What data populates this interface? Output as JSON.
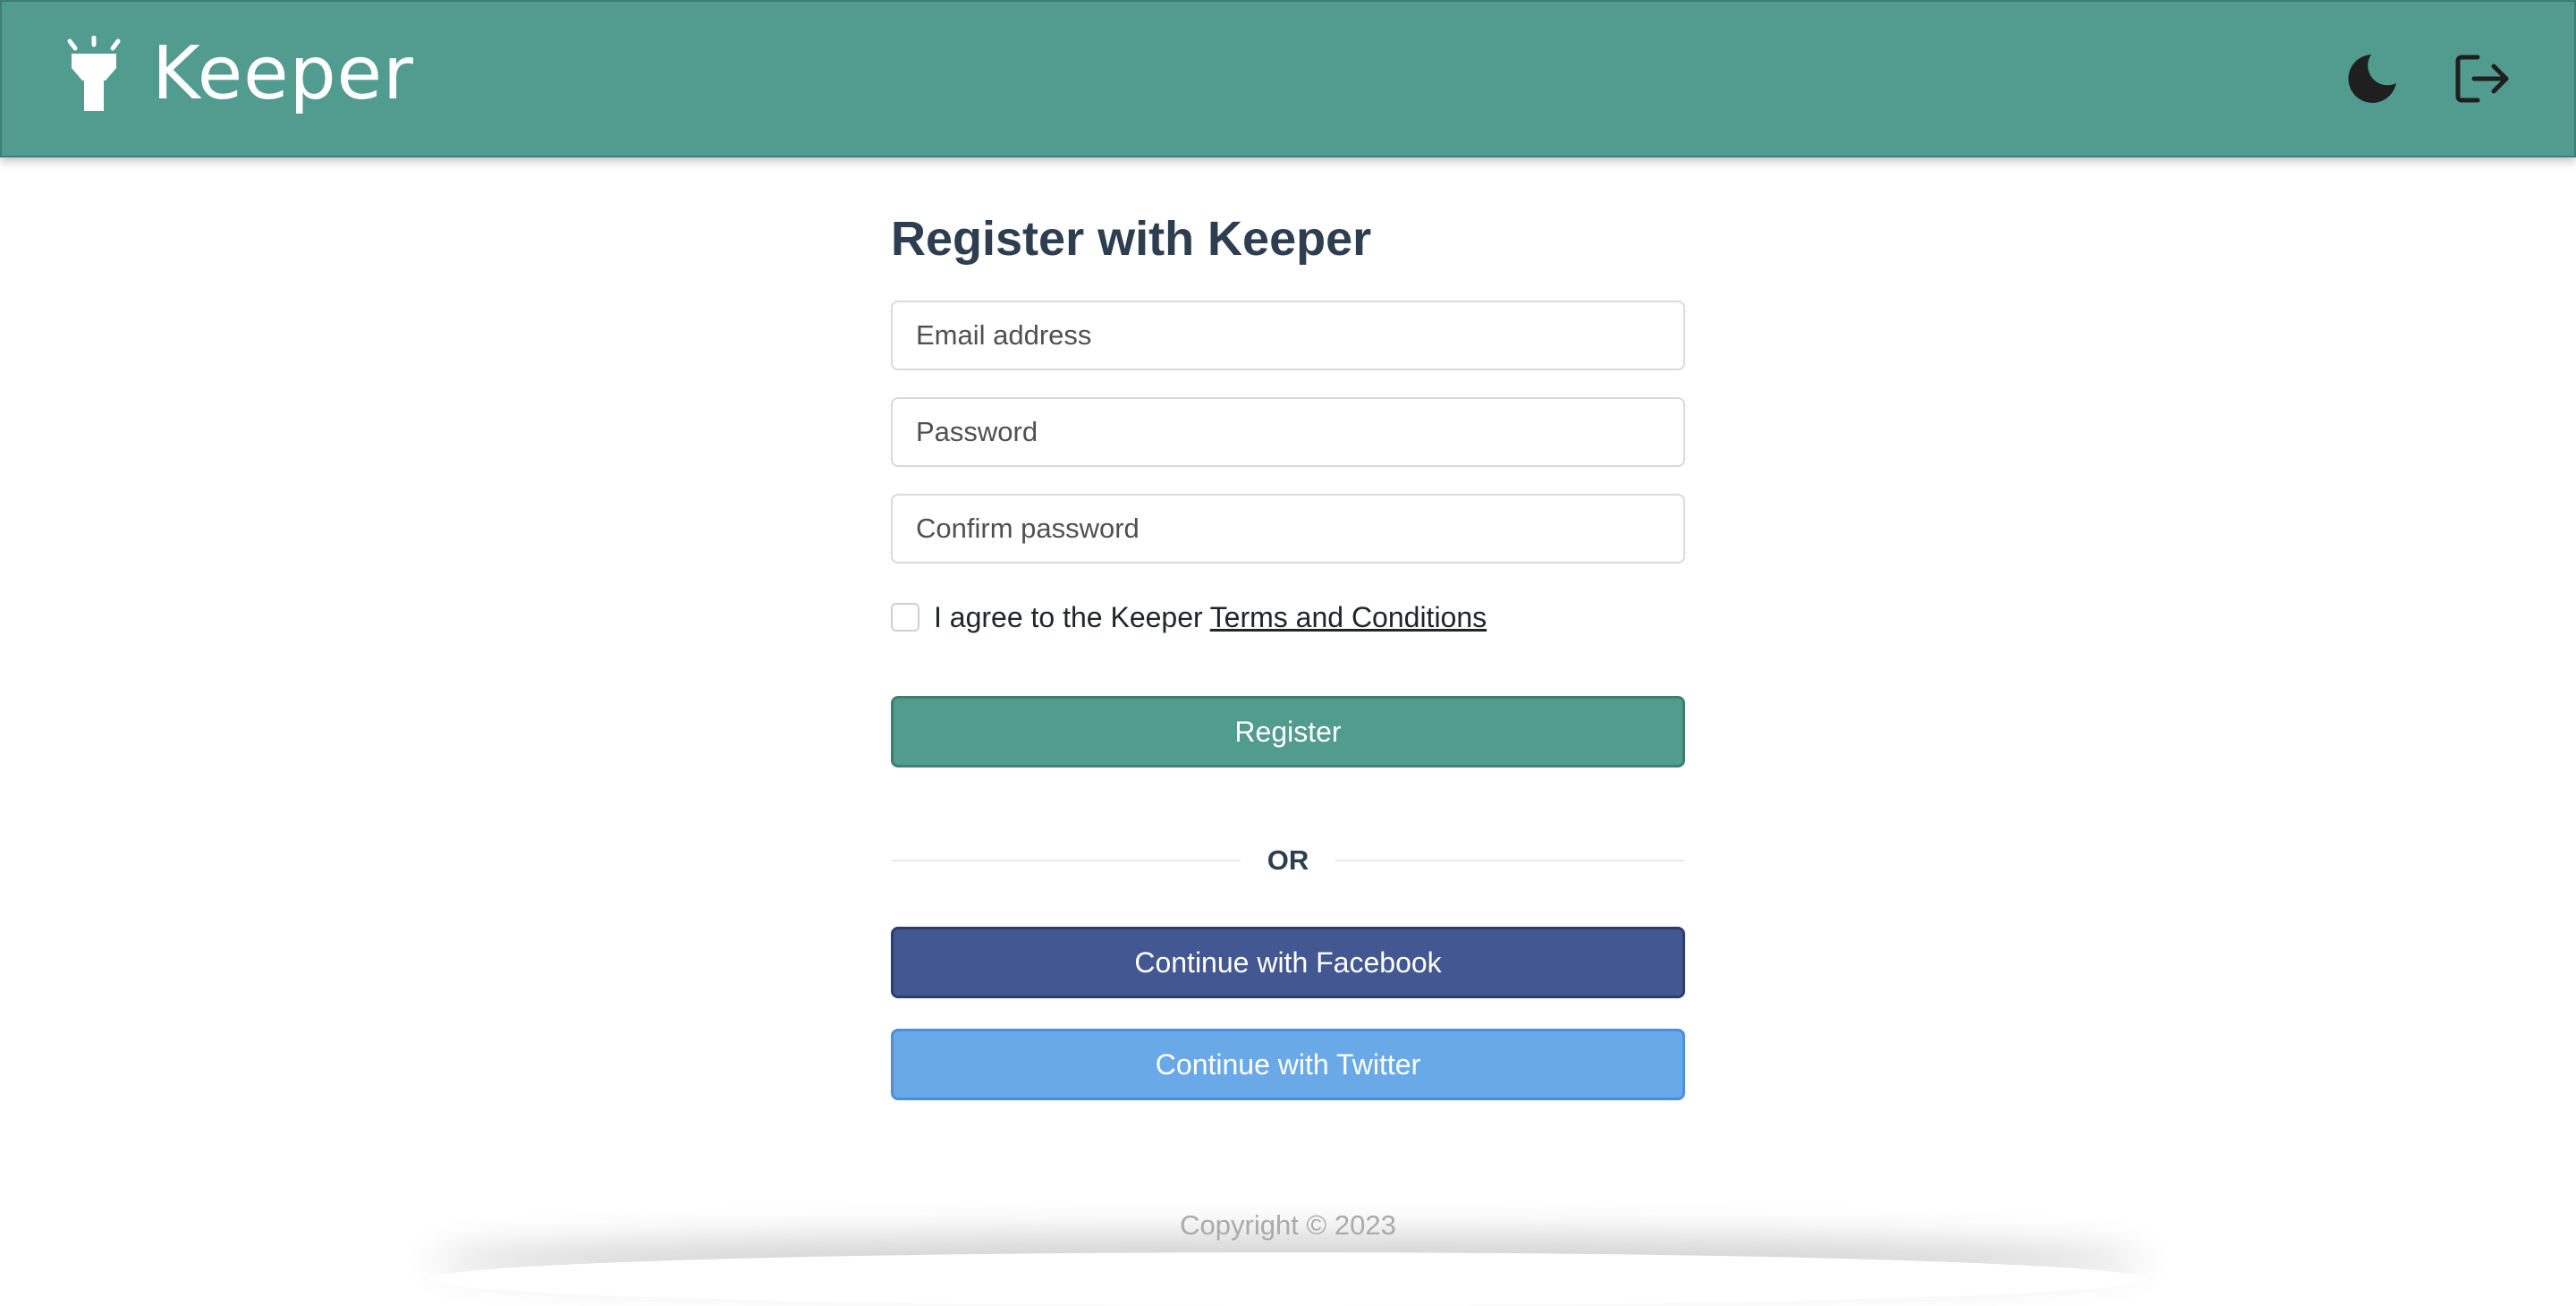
{
  "header": {
    "brand_name": "Keeper",
    "brand_icon": "flashlight-icon",
    "theme_toggle_icon": "moon-icon",
    "logout_icon": "logout-icon",
    "background_color": "#519c8f"
  },
  "form": {
    "title": "Register with Keeper",
    "email": {
      "placeholder": "Email address",
      "value": ""
    },
    "password": {
      "placeholder": "Password",
      "value": ""
    },
    "confirm_password": {
      "placeholder": "Confirm password",
      "value": ""
    },
    "terms_checked": false,
    "terms_text": "I agree to the Keeper",
    "terms_link": "Terms and Conditions",
    "register_label": "Register",
    "divider_label": "OR",
    "facebook_label": "Continue with Facebook",
    "twitter_label": "Continue with Twitter"
  },
  "colors": {
    "primary": "#519c8f",
    "facebook": "#435792",
    "twitter": "#6aa9e7",
    "title": "#2c3e50"
  },
  "footer": {
    "copyright": "Copyright © 2023"
  }
}
